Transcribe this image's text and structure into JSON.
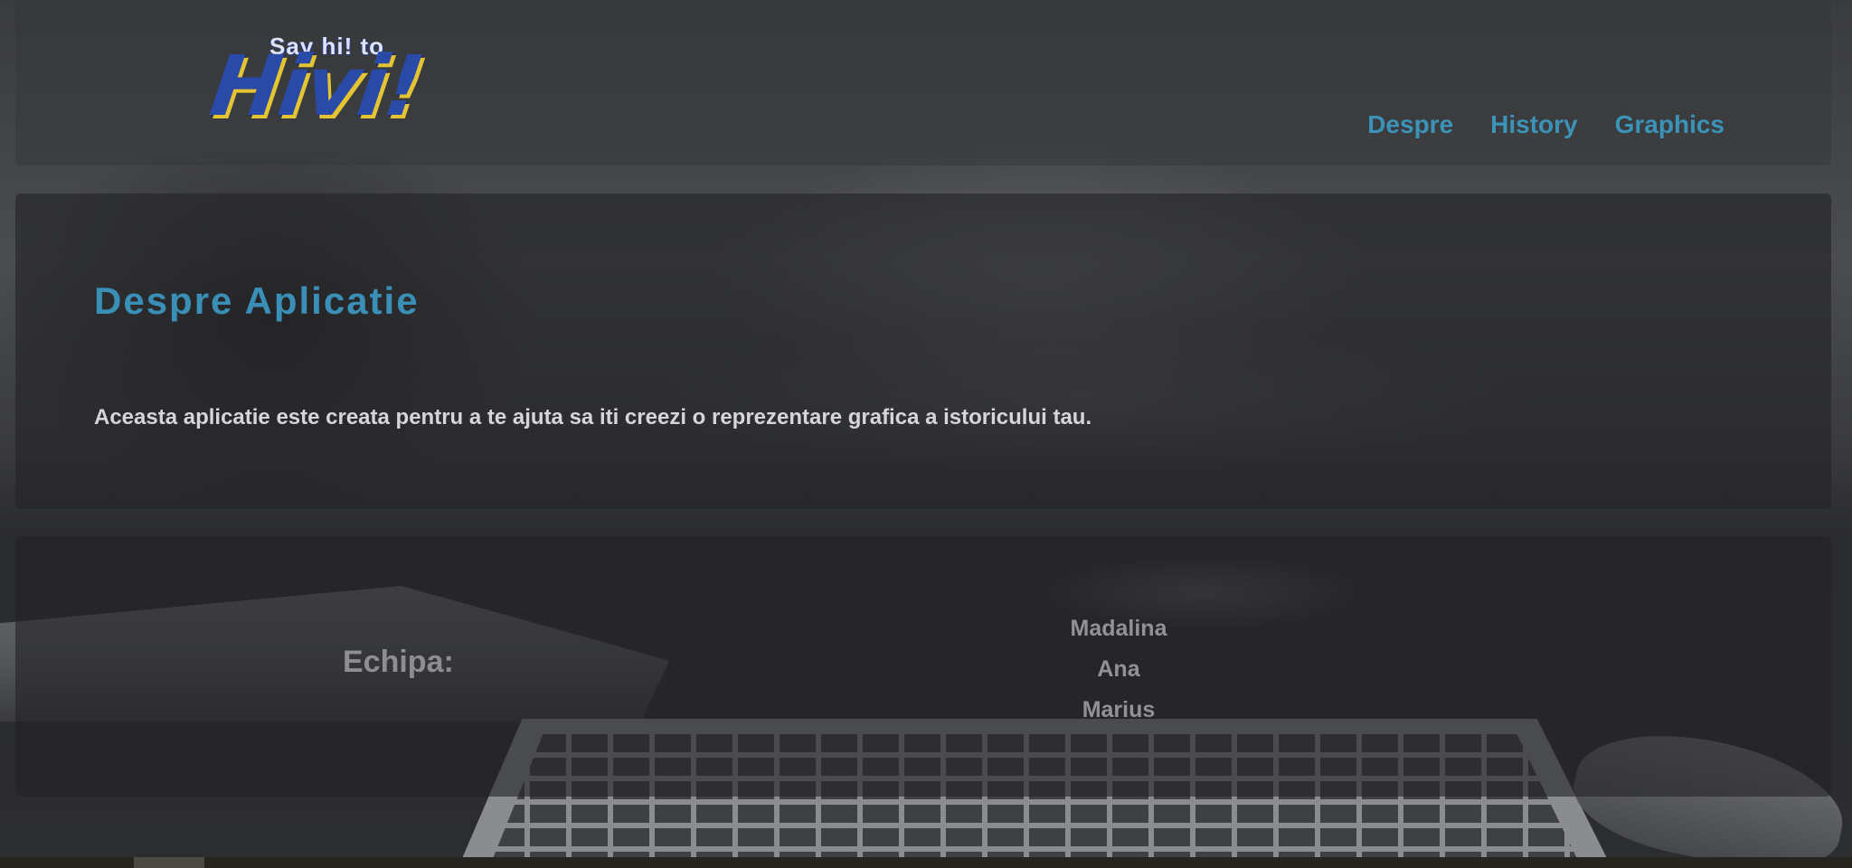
{
  "logo": {
    "tagline": "Say hi! to",
    "name": "Hivi!"
  },
  "nav": {
    "items": [
      {
        "label": "Despre"
      },
      {
        "label": "History"
      },
      {
        "label": "Graphics"
      }
    ]
  },
  "about": {
    "title": "Despre Aplicatie",
    "description": "Aceasta aplicatie este creata pentru a te ajuta sa iti creezi o reprezentare grafica a istoricului tau."
  },
  "team": {
    "label": "Echipa:",
    "members": [
      "Madalina",
      "Ana",
      "Marius"
    ]
  },
  "colors": {
    "accent": "#3a8fb7",
    "logo_blue": "#2a4aa8",
    "logo_yellow": "#e4c433"
  }
}
